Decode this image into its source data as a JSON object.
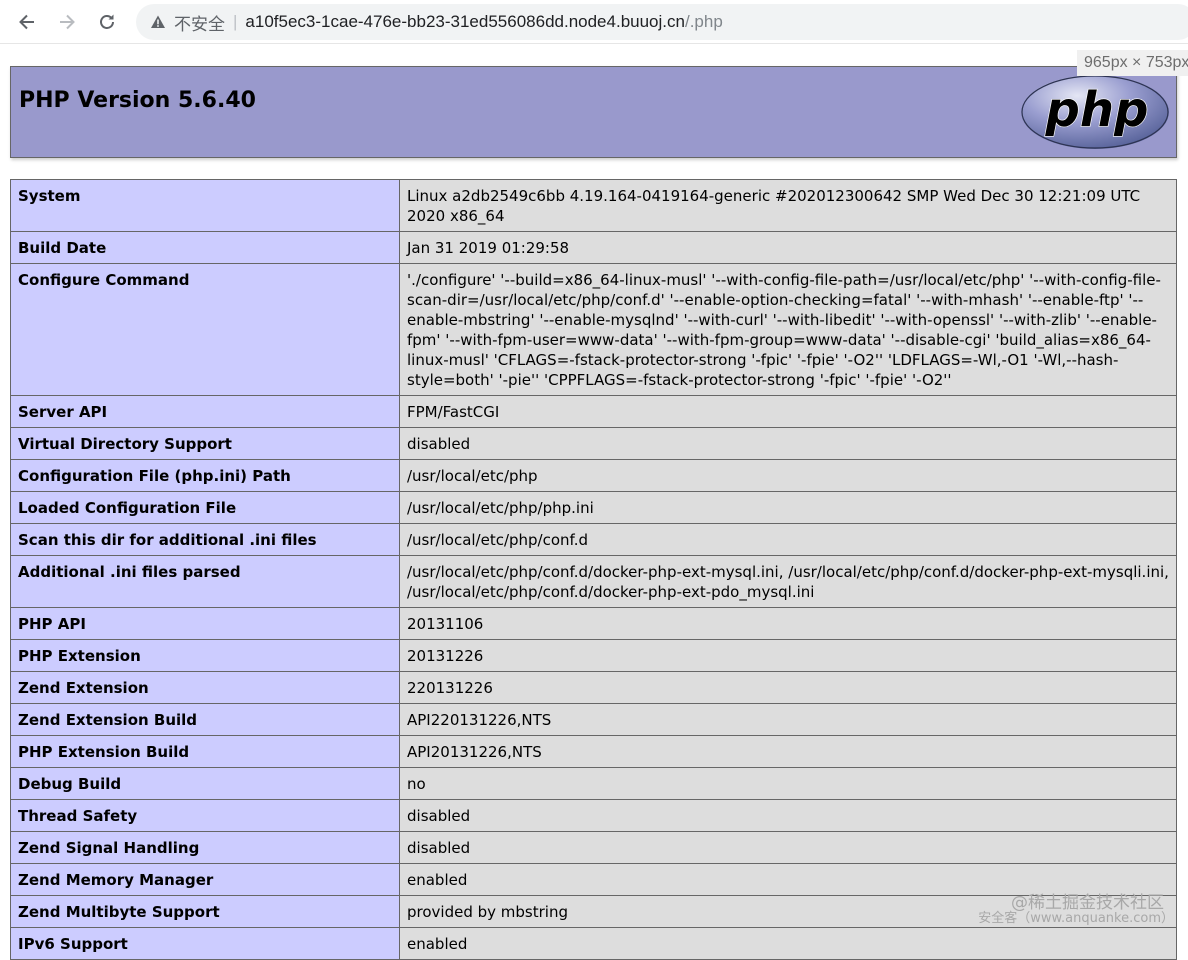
{
  "browser": {
    "security_label": "不安全",
    "separator": "|",
    "url_host": "a10f5ec3-1cae-476e-bb23-31ed556086dd.node4.buuoj.cn",
    "url_path": "/.php"
  },
  "size_tooltip": "965px × 753px",
  "header": {
    "title": "PHP Version 5.6.40",
    "logo_text": "php"
  },
  "rows": [
    {
      "label": "System",
      "value": "Linux a2db2549c6bb 4.19.164-0419164-generic #202012300642 SMP Wed Dec 30 12:21:09 UTC 2020 x86_64"
    },
    {
      "label": "Build Date",
      "value": "Jan 31 2019 01:29:58"
    },
    {
      "label": "Configure Command",
      "value": "'./configure' '--build=x86_64-linux-musl' '--with-config-file-path=/usr/local/etc/php' '--with-config-file-scan-dir=/usr/local/etc/php/conf.d' '--enable-option-checking=fatal' '--with-mhash' '--enable-ftp' '--enable-mbstring' '--enable-mysqlnd' '--with-curl' '--with-libedit' '--with-openssl' '--with-zlib' '--enable-fpm' '--with-fpm-user=www-data' '--with-fpm-group=www-data' '--disable-cgi' 'build_alias=x86_64-linux-musl' 'CFLAGS=-fstack-protector-strong '-fpic' '-fpie' '-O2'' 'LDFLAGS=-Wl,-O1 '-Wl,--hash-style=both' '-pie'' 'CPPFLAGS=-fstack-protector-strong '-fpic' '-fpie' '-O2''"
    },
    {
      "label": "Server API",
      "value": "FPM/FastCGI"
    },
    {
      "label": "Virtual Directory Support",
      "value": "disabled"
    },
    {
      "label": "Configuration File (php.ini) Path",
      "value": "/usr/local/etc/php"
    },
    {
      "label": "Loaded Configuration File",
      "value": "/usr/local/etc/php/php.ini"
    },
    {
      "label": "Scan this dir for additional .ini files",
      "value": "/usr/local/etc/php/conf.d"
    },
    {
      "label": "Additional .ini files parsed",
      "value": "/usr/local/etc/php/conf.d/docker-php-ext-mysql.ini, /usr/local/etc/php/conf.d/docker-php-ext-mysqli.ini, /usr/local/etc/php/conf.d/docker-php-ext-pdo_mysql.ini"
    },
    {
      "label": "PHP API",
      "value": "20131106"
    },
    {
      "label": "PHP Extension",
      "value": "20131226"
    },
    {
      "label": "Zend Extension",
      "value": "220131226"
    },
    {
      "label": "Zend Extension Build",
      "value": "API220131226,NTS"
    },
    {
      "label": "PHP Extension Build",
      "value": "API20131226,NTS"
    },
    {
      "label": "Debug Build",
      "value": "no"
    },
    {
      "label": "Thread Safety",
      "value": "disabled"
    },
    {
      "label": "Zend Signal Handling",
      "value": "disabled"
    },
    {
      "label": "Zend Memory Manager",
      "value": "enabled"
    },
    {
      "label": "Zend Multibyte Support",
      "value": "provided by mbstring"
    },
    {
      "label": "IPv6 Support",
      "value": "enabled"
    }
  ],
  "watermark": {
    "line1": "@稀土掘金技术社区",
    "line2": "安全客（www.anquanke.com）"
  },
  "colors": {
    "header_bg": "#9999cc",
    "label_cell_bg": "#ccccff",
    "value_cell_bg": "#dddddd",
    "border": "#666666"
  }
}
